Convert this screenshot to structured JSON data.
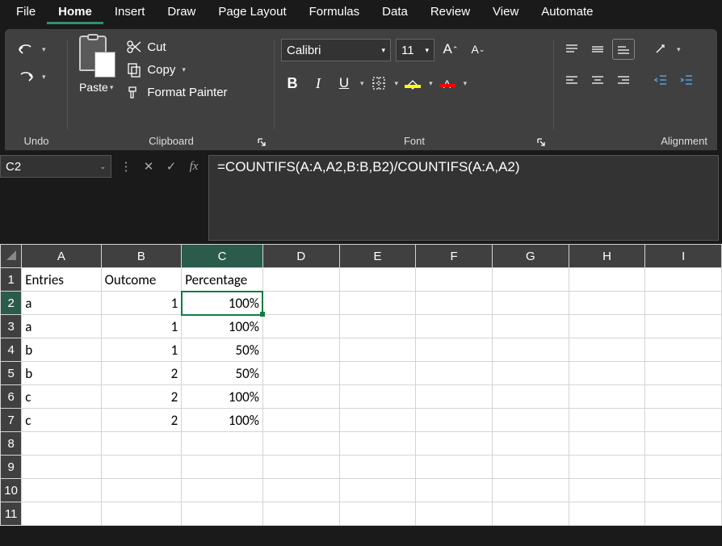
{
  "tabs": {
    "file": "File",
    "home": "Home",
    "insert": "Insert",
    "draw": "Draw",
    "page_layout": "Page Layout",
    "formulas": "Formulas",
    "data": "Data",
    "review": "Review",
    "view": "View",
    "automate": "Automate"
  },
  "ribbon": {
    "undo_label": "Undo",
    "paste_label": "Paste",
    "cut": "Cut",
    "copy": "Copy",
    "format_painter": "Format Painter",
    "clipboard_label": "Clipboard",
    "font_name": "Calibri",
    "font_size": "11",
    "font_label": "Font",
    "alignment_label": "Alignment"
  },
  "name_box": "C2",
  "formula": "=COUNTIFS(A:A,A2,B:B,B2)/COUNTIFS(A:A,A2)",
  "columns": [
    "A",
    "B",
    "C",
    "D",
    "E",
    "F",
    "G",
    "H",
    "I"
  ],
  "rows_count": 11,
  "selected_cell": {
    "row": 2,
    "col": "C"
  },
  "headers": {
    "A": "Entries",
    "B": "Outcome",
    "C": "Percentage"
  },
  "data": [
    {
      "A": "a",
      "B": "1",
      "C": "100%"
    },
    {
      "A": "a",
      "B": "1",
      "C": "100%"
    },
    {
      "A": "b",
      "B": "1",
      "C": "50%"
    },
    {
      "A": "b",
      "B": "2",
      "C": "50%"
    },
    {
      "A": "c",
      "B": "2",
      "C": "100%"
    },
    {
      "A": "c",
      "B": "2",
      "C": "100%"
    }
  ]
}
